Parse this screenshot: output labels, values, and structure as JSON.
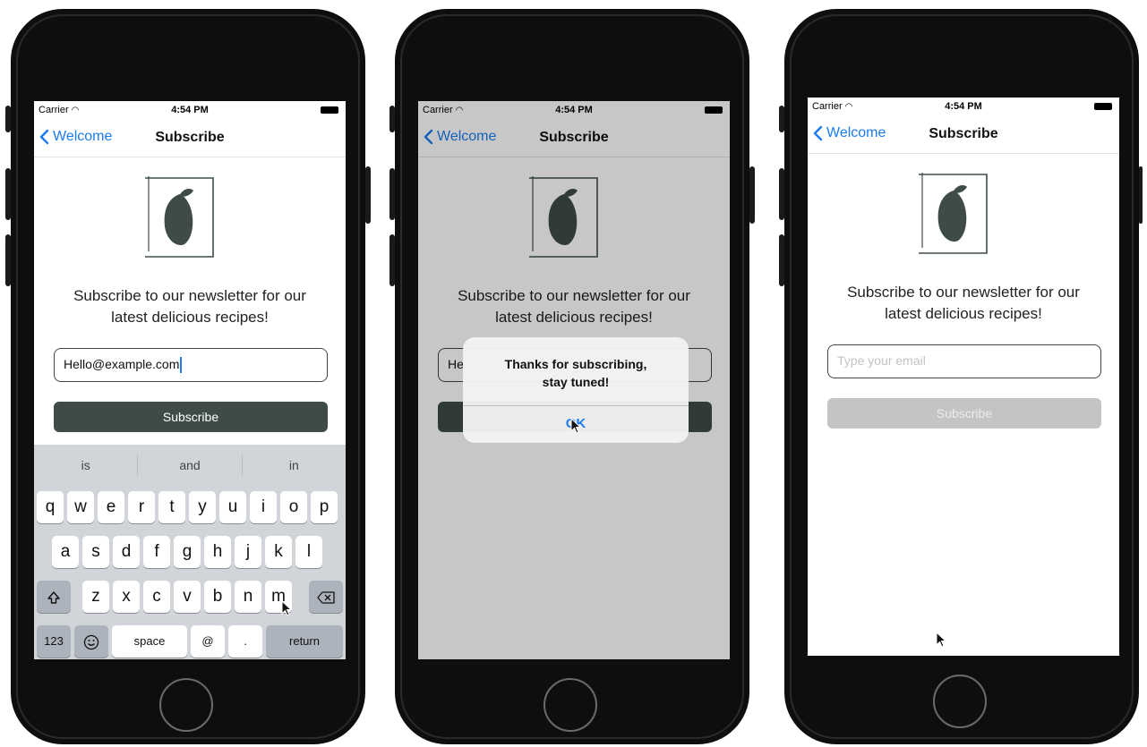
{
  "status": {
    "carrier": "Carrier",
    "wifi_icon": "wifi-icon",
    "time": "4:54 PM",
    "battery_icon": "battery-icon"
  },
  "nav": {
    "back_label": "Welcome",
    "title": "Subscribe"
  },
  "headline_line1": "Subscribe to our newsletter for our",
  "headline_line2": "latest delicious recipes!",
  "screens": {
    "typing": {
      "email_value": "Hello@example.com",
      "subscribe_label": "Subscribe"
    },
    "alert": {
      "email_value_partial": "He",
      "message_line1": "Thanks for subscribing,",
      "message_line2": "stay tuned!",
      "ok_label": "OK"
    },
    "reset": {
      "email_placeholder": "Type your email",
      "subscribe_label": "Subscribe"
    }
  },
  "keyboard": {
    "suggestions": [
      "is",
      "and",
      "in"
    ],
    "row1": [
      "q",
      "w",
      "e",
      "r",
      "t",
      "y",
      "u",
      "i",
      "o",
      "p"
    ],
    "row2": [
      "a",
      "s",
      "d",
      "f",
      "g",
      "h",
      "j",
      "k",
      "l"
    ],
    "row3": [
      "z",
      "x",
      "c",
      "v",
      "b",
      "n",
      "m"
    ],
    "numbers_label": "123",
    "emoji_icon": "emoji-icon",
    "space_label": "space",
    "at_label": "@",
    "dot_label": ".",
    "return_label": "return",
    "shift_icon": "shift-icon",
    "delete_icon": "delete-icon"
  },
  "colors": {
    "accent": "#1a7cf0",
    "brand": "#3f4c46",
    "disabled": "#c4c4c4"
  }
}
